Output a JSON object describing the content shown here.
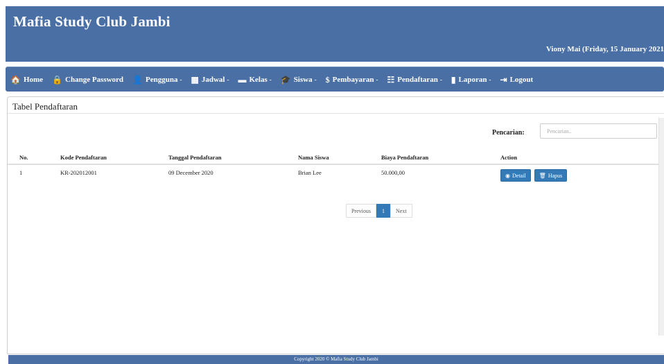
{
  "app": {
    "title": "Mafia Study Club Jambi",
    "user_info": "Viony Mai (Friday, 15 January 2021"
  },
  "nav": [
    {
      "label": "Home",
      "icon": "home-icon",
      "glyph": "🏠",
      "caret": ""
    },
    {
      "label": "Change Password",
      "icon": "lock-icon",
      "glyph": "🔒",
      "caret": ""
    },
    {
      "label": "Pengguna",
      "icon": "user-icon",
      "glyph": "👤",
      "caret": "▾"
    },
    {
      "label": "Jadwal",
      "icon": "calendar-icon",
      "glyph": "▦",
      "caret": "▾"
    },
    {
      "label": "Kelas",
      "icon": "comment-icon",
      "glyph": "▬",
      "caret": "▾"
    },
    {
      "label": "Siswa",
      "icon": "graduation-icon",
      "glyph": "🎓",
      "caret": "▾"
    },
    {
      "label": "Pembayaran",
      "icon": "dollar-icon",
      "glyph": "$",
      "caret": "▾"
    },
    {
      "label": "Pendaftaran",
      "icon": "list-icon",
      "glyph": "☷",
      "caret": "▾"
    },
    {
      "label": "Laporan",
      "icon": "file-icon",
      "glyph": "▮",
      "caret": "▾"
    },
    {
      "label": "Logout",
      "icon": "logout-icon",
      "glyph": "⇥",
      "caret": ""
    }
  ],
  "panel": {
    "title": "Tabel Pendaftaran",
    "search": {
      "label": "Pencarian:",
      "placeholder": "Pencarian..",
      "value": ""
    }
  },
  "table": {
    "headers": [
      "No.",
      "Kode Pendaftaran",
      "Tanggal Pendaftaran",
      "Nama Siswa",
      "Biaya Pendaftaran",
      "Action"
    ],
    "rows": [
      {
        "no": "1",
        "kode": "KR-202012001",
        "tanggal": "09 December 2020",
        "nama": "Brian Lee",
        "biaya": "50.000,00"
      }
    ],
    "actions": {
      "detail": "Detail",
      "hapus": "Hapus"
    }
  },
  "pagination": {
    "previous": "Previous",
    "current": "1",
    "next": "Next"
  },
  "footer": {
    "text": "Copyright 2020 © Mafia Study Club Jambi"
  },
  "colors": {
    "primary": "#4a6fa5",
    "button": "#337ab7"
  }
}
